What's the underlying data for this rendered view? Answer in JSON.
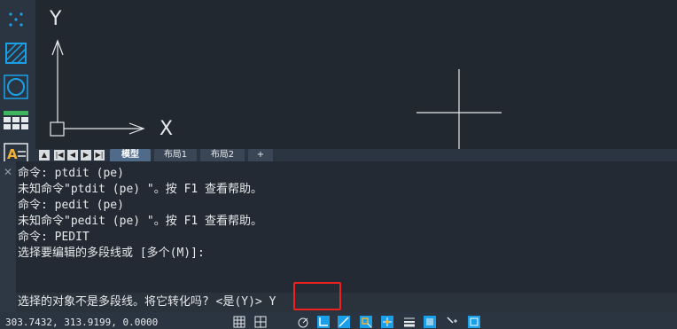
{
  "canvas": {
    "y_axis_label": "Y",
    "x_axis_label": "X"
  },
  "layout_tabs": {
    "nav_buttons": [
      "▲",
      "|◀",
      "◀",
      "▶",
      "▶|"
    ],
    "tabs": [
      "模型",
      "布局1",
      "布局2",
      "+"
    ],
    "active_index": 0
  },
  "command_window": {
    "close_glyph": "✕",
    "history": [
      "命令: ptdit (pe)",
      "未知命令\"ptdit (pe) \"。按 F1 查看帮助。",
      "命令: pedit (pe)",
      "未知命令\"pedit (pe) \"。按 F1 查看帮助。",
      "命令: PEDIT",
      "选择要编辑的多段线或 [多个(M)]:"
    ],
    "current_prompt": "选择的对象不是多段线。将它转化吗? <是(Y)> Y"
  },
  "status_bar": {
    "coordinates": "303.7432, 313.9199, 0.0000"
  },
  "colors": {
    "background": "#212830",
    "panel": "#2b3542",
    "accent_blue": "#1aa0e8",
    "highlight_red": "#ee2020"
  }
}
